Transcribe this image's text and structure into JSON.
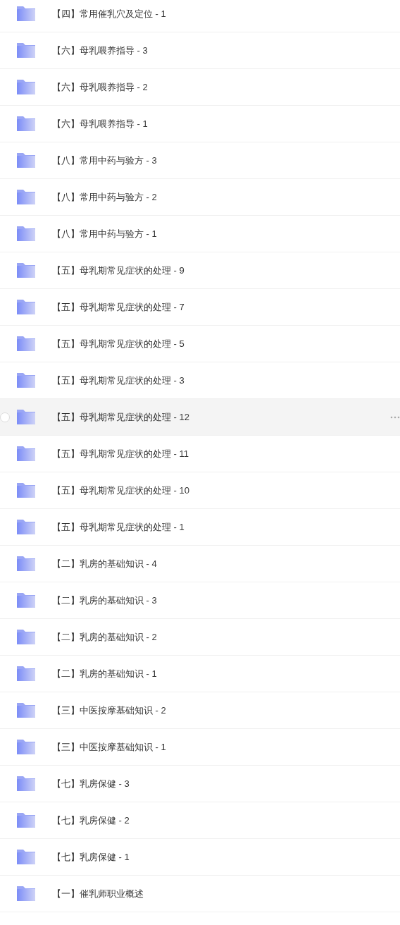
{
  "folders": [
    {
      "name": "【四】常用催乳穴及定位 - 1",
      "hovered": false
    },
    {
      "name": "【六】母乳喂养指导 - 3",
      "hovered": false
    },
    {
      "name": "【六】母乳喂养指导 - 2",
      "hovered": false
    },
    {
      "name": "【六】母乳喂养指导 - 1",
      "hovered": false
    },
    {
      "name": "【八】常用中药与验方 - 3",
      "hovered": false
    },
    {
      "name": "【八】常用中药与验方 - 2",
      "hovered": false
    },
    {
      "name": "【八】常用中药与验方 - 1",
      "hovered": false
    },
    {
      "name": "【五】母乳期常见症状的处理 - 9",
      "hovered": false
    },
    {
      "name": "【五】母乳期常见症状的处理 - 7",
      "hovered": false
    },
    {
      "name": "【五】母乳期常见症状的处理 - 5",
      "hovered": false
    },
    {
      "name": "【五】母乳期常见症状的处理 - 3",
      "hovered": false
    },
    {
      "name": "【五】母乳期常见症状的处理 - 12",
      "hovered": true
    },
    {
      "name": "【五】母乳期常见症状的处理 - 11",
      "hovered": false
    },
    {
      "name": "【五】母乳期常见症状的处理 - 10",
      "hovered": false
    },
    {
      "name": "【五】母乳期常见症状的处理 - 1",
      "hovered": false
    },
    {
      "name": "【二】乳房的基础知识 - 4",
      "hovered": false
    },
    {
      "name": "【二】乳房的基础知识 - 3",
      "hovered": false
    },
    {
      "name": "【二】乳房的基础知识 - 2",
      "hovered": false
    },
    {
      "name": "【二】乳房的基础知识 - 1",
      "hovered": false
    },
    {
      "name": "【三】中医按摩基础知识 - 2",
      "hovered": false
    },
    {
      "name": "【三】中医按摩基础知识 - 1",
      "hovered": false
    },
    {
      "name": "【七】乳房保健 - 3",
      "hovered": false
    },
    {
      "name": "【七】乳房保健 - 2",
      "hovered": false
    },
    {
      "name": "【七】乳房保健 - 1",
      "hovered": false
    },
    {
      "name": "【一】催乳师职业概述",
      "hovered": false
    }
  ]
}
